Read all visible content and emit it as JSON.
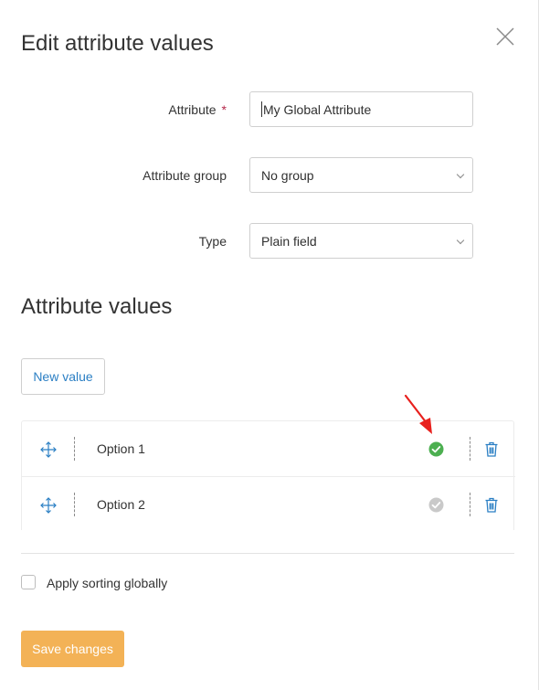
{
  "dialog": {
    "title": "Edit attribute values",
    "close_icon": "close-icon"
  },
  "form": {
    "attribute_label": "Attribute",
    "required_mark": "*",
    "attribute_value": "My Global Attribute",
    "group_label": "Attribute group",
    "group_value": "No group",
    "type_label": "Type",
    "type_value": "Plain field"
  },
  "values_section": {
    "title": "Attribute values",
    "new_value_label": "New value",
    "items": [
      {
        "label": "Option 1",
        "status": "active",
        "status_color": "#4caf50"
      },
      {
        "label": "Option 2",
        "status": "inactive",
        "status_color": "#c9c9c9"
      }
    ]
  },
  "options": {
    "apply_sorting_label": "Apply sorting globally",
    "apply_sorting_checked": false
  },
  "footer": {
    "save_label": "Save changes"
  },
  "colors": {
    "accent_blue": "#2b7fc4",
    "save_button": "#f3b256",
    "required": "#b5294b",
    "annotation_arrow": "#e8201d"
  }
}
